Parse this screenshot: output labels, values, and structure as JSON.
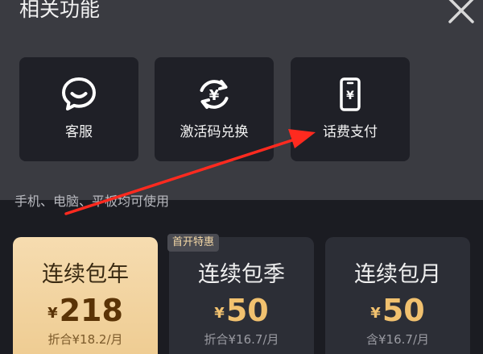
{
  "sheet": {
    "title": "相关功能",
    "features": [
      {
        "label": "客服",
        "icon": "chat-bubble-icon"
      },
      {
        "label": "激活码兑换",
        "icon": "yuan-exchange-icon"
      },
      {
        "label": "话费支付",
        "icon": "phone-yuan-icon"
      }
    ]
  },
  "page": {
    "usage_note": "手机、电脑、平板均可使用",
    "promo_badge": "首开特惠",
    "plans": [
      {
        "name": "连续包年",
        "currency": "¥",
        "amount": "218",
        "sub": "折合¥18.2/月",
        "selected": true
      },
      {
        "name": "连续包季",
        "currency": "¥",
        "amount": "50",
        "sub": "折合¥16.7/月",
        "selected": false
      },
      {
        "name": "连续包月",
        "currency": "¥",
        "amount": "50",
        "sub": "含¥16.7/月",
        "selected": false
      }
    ]
  },
  "colors": {
    "sheet_bg": "#3a3b41",
    "card_bg": "#1f2027",
    "page_bg": "#1b1c22",
    "gold": "#f1c16f",
    "selected_card": "#f6dcb0",
    "arrow": "#ff2a1f"
  }
}
